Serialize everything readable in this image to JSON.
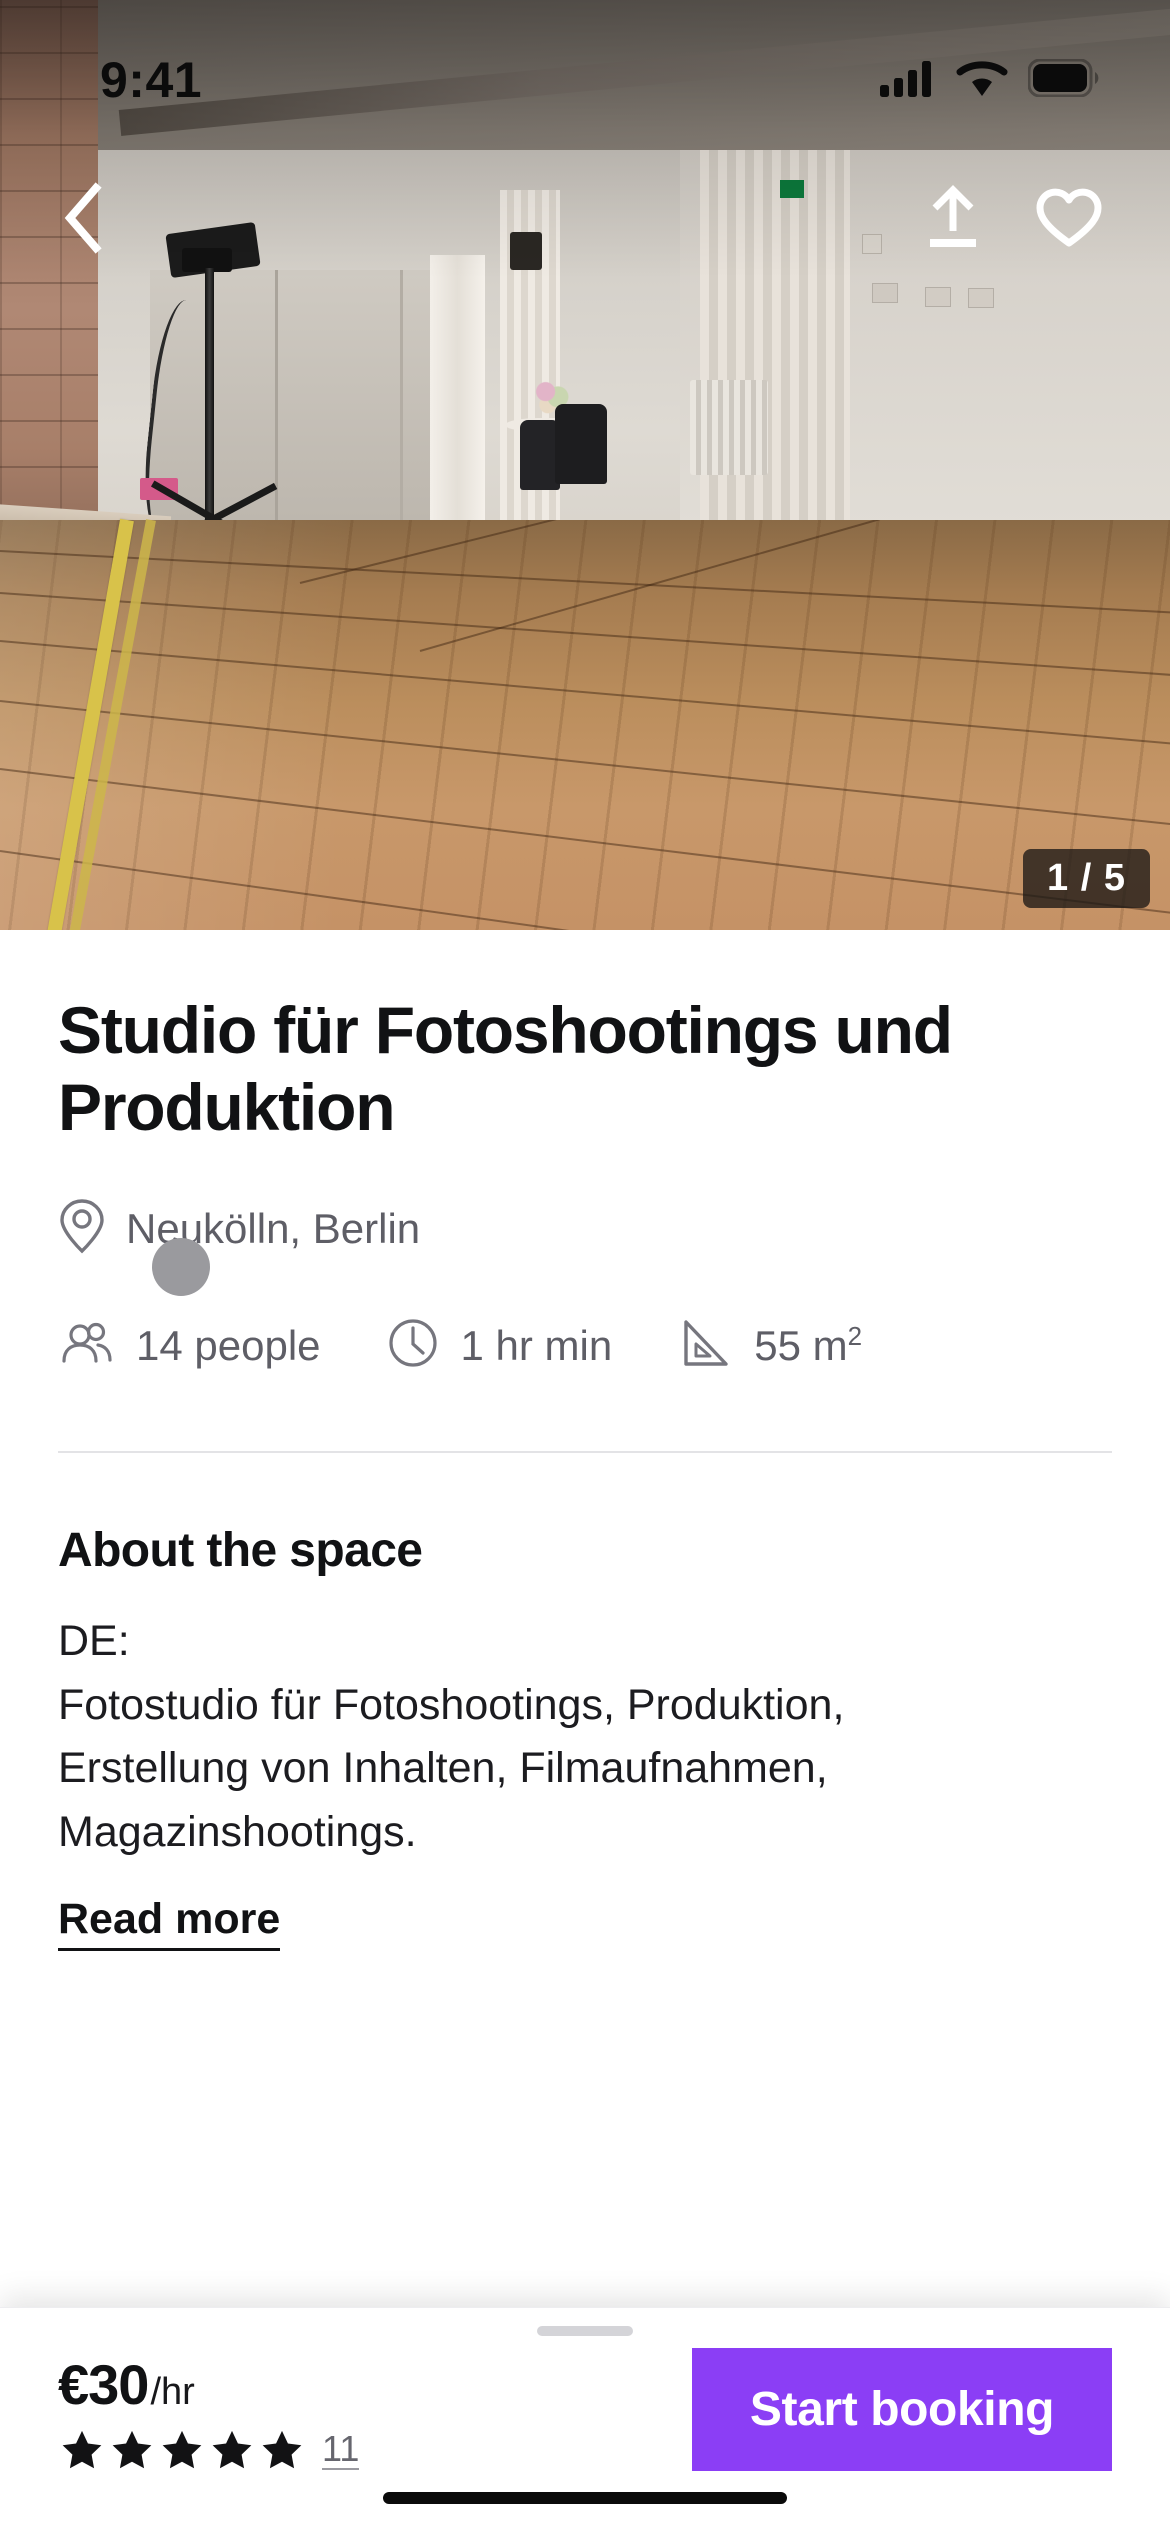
{
  "status_bar": {
    "time": "9:41",
    "icons": [
      "cellular-signal-icon",
      "wifi-icon",
      "battery-icon"
    ]
  },
  "gallery": {
    "back_icon": "chevron-left-icon",
    "share_icon": "share-upload-icon",
    "favorite_icon": "heart-icon",
    "counter": "1 / 5",
    "current_index": 1,
    "total": 5
  },
  "listing": {
    "title": "Studio für Fotoshootings und Produktion",
    "location": "Neukölln, Berlin",
    "location_icon": "map-pin-icon",
    "meta": [
      {
        "icon": "people-icon",
        "label": "14 people"
      },
      {
        "icon": "clock-icon",
        "label": "1 hr min"
      },
      {
        "icon": "area-ruler-icon",
        "label_value": "55 m",
        "label_sup": "2"
      }
    ]
  },
  "about": {
    "heading": "About the space",
    "paragraphs": [
      "DE:",
      "Fotostudio für Fotoshootings, Produktion,",
      "Erstellung von Inhalten, Filmaufnahmen,",
      "Magazinshootings."
    ],
    "read_more": "Read more"
  },
  "booking_bar": {
    "price_amount": "€30",
    "price_unit": "/hr",
    "rating_stars": 5,
    "review_count": "11",
    "cta_label": "Start booking",
    "cta_color": "#8b3ef5"
  }
}
